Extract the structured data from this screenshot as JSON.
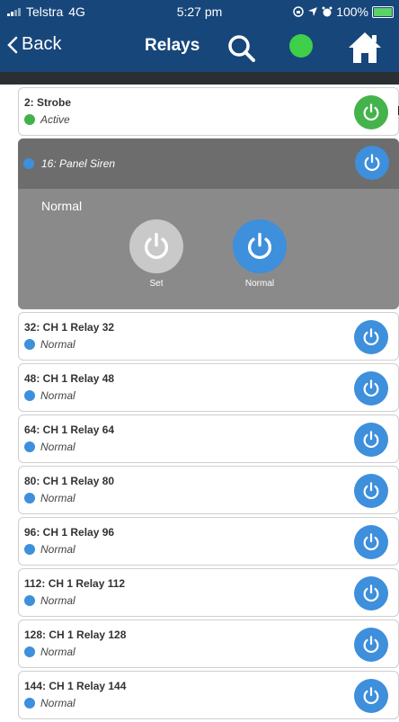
{
  "status_bar": {
    "carrier": "Telstra",
    "network": "4G",
    "time": "5:27 pm",
    "battery": "100%",
    "icons": [
      "signal-icon",
      "orientation-lock-icon",
      "location-icon",
      "alarm-icon",
      "battery-icon"
    ]
  },
  "nav": {
    "back_label": "Back",
    "title": "Relays",
    "connection_color": "#3fcf4a",
    "icons": [
      "chevron-left-icon",
      "search-icon",
      "home-icon"
    ]
  },
  "colors": {
    "header": "#17467a",
    "active": "#3fb24a",
    "normal": "#3e8fdc",
    "set_option": "#c9c9c9"
  },
  "relays": {
    "r2": {
      "name": "2: Strobe",
      "state": "Active"
    },
    "r16": {
      "name": "16: Panel Siren",
      "current": "Normal",
      "options": {
        "set": "Set",
        "normal": "Normal"
      }
    },
    "r32": {
      "name": "32: CH 1 Relay 32",
      "state": "Normal"
    },
    "r48": {
      "name": "48: CH 1 Relay 48",
      "state": "Normal"
    },
    "r64": {
      "name": "64: CH 1 Relay 64",
      "state": "Normal"
    },
    "r80": {
      "name": "80: CH 1 Relay 80",
      "state": "Normal"
    },
    "r96": {
      "name": "96: CH 1 Relay 96",
      "state": "Normal"
    },
    "r112": {
      "name": "112: CH 1 Relay 112",
      "state": "Normal"
    },
    "r128": {
      "name": "128: CH 1 Relay 128",
      "state": "Normal"
    },
    "r144": {
      "name": "144: CH 1 Relay 144",
      "state": "Normal"
    }
  }
}
